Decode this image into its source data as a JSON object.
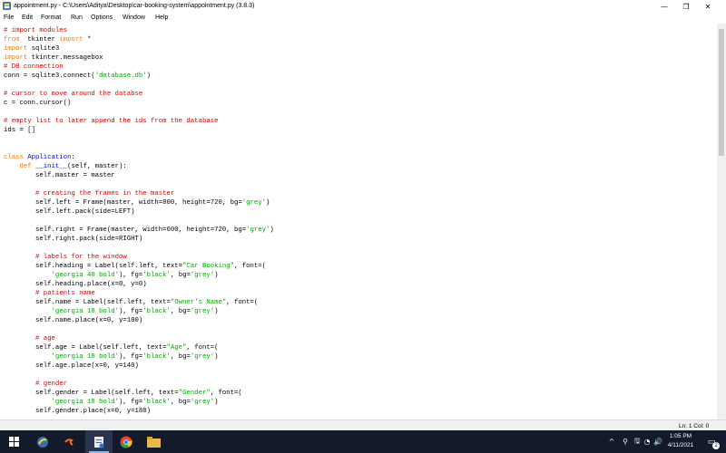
{
  "window": {
    "title": "appointment.py - C:\\Users\\Aditya\\Desktop\\car-booking-system\\appointment.py (3.8.3)",
    "controls": {
      "minimize_glyph": "—",
      "maximize_glyph": "❐",
      "close_glyph": "✕"
    }
  },
  "menu": [
    "File",
    "Edit",
    "Format",
    "Run",
    "Options",
    "Window",
    "Help"
  ],
  "code": [
    [
      [
        "cm",
        "# import modules"
      ]
    ],
    [
      [
        "kw",
        "from"
      ],
      [
        "",
        "  tkinter "
      ],
      [
        "kw",
        "import"
      ],
      [
        "",
        " *"
      ]
    ],
    [
      [
        "kw",
        "import"
      ],
      [
        "",
        " sqlite3"
      ]
    ],
    [
      [
        "kw",
        "import"
      ],
      [
        "",
        " tkinter.messagebox"
      ]
    ],
    [
      [
        "cm",
        "# DB connection"
      ]
    ],
    [
      [
        "",
        "conn = sqlite3.connect("
      ],
      [
        "st",
        "'database.db'"
      ],
      [
        "",
        ")"
      ]
    ],
    [],
    [
      [
        "cm",
        "# cursor to move around the databse"
      ]
    ],
    [
      [
        "",
        "c = conn.cursor()"
      ]
    ],
    [],
    [
      [
        "cm",
        "# empty list to later append the ids from the database"
      ]
    ],
    [
      [
        "",
        "ids = []"
      ]
    ],
    [],
    [],
    [
      [
        "kw",
        "class"
      ],
      [
        "",
        " "
      ],
      [
        "df",
        "Application"
      ],
      [
        "",
        ":"
      ]
    ],
    [
      [
        "",
        "    "
      ],
      [
        "kw",
        "def"
      ],
      [
        "",
        " "
      ],
      [
        "df",
        "__init__"
      ],
      [
        "",
        "(self, master):"
      ]
    ],
    [
      [
        "",
        "        self.master = master"
      ]
    ],
    [],
    [
      [
        "",
        "        "
      ],
      [
        "cm",
        "# creating the frames in the master"
      ]
    ],
    [
      [
        "",
        "        self.left = Frame(master, width=800, height=720, bg="
      ],
      [
        "st",
        "'grey'"
      ],
      [
        "",
        ")"
      ]
    ],
    [
      [
        "",
        "        self.left.pack(side=LEFT)"
      ]
    ],
    [],
    [
      [
        "",
        "        self.right = Frame(master, width=600, height=720, bg="
      ],
      [
        "st",
        "'grey'"
      ],
      [
        "",
        ")"
      ]
    ],
    [
      [
        "",
        "        self.right.pack(side=RIGHT)"
      ]
    ],
    [],
    [
      [
        "",
        "        "
      ],
      [
        "cm",
        "# labels for the window"
      ]
    ],
    [
      [
        "",
        "        self.heading = Label(self.left, text="
      ],
      [
        "st",
        "\"Car Booking\""
      ],
      [
        "",
        ", font=("
      ]
    ],
    [
      [
        "",
        "            "
      ],
      [
        "st",
        "'georgia 40 bold'"
      ],
      [
        "",
        "), fg="
      ],
      [
        "st",
        "'black'"
      ],
      [
        "",
        ", bg="
      ],
      [
        "st",
        "'grey'"
      ],
      [
        "",
        ")"
      ]
    ],
    [
      [
        "",
        "        self.heading.place(x=0, y=0)"
      ]
    ],
    [
      [
        "",
        "        "
      ],
      [
        "cm",
        "# patients name"
      ]
    ],
    [
      [
        "",
        "        self.name = Label(self.left, text="
      ],
      [
        "st",
        "\"Owner's Name\""
      ],
      [
        "",
        ", font=("
      ]
    ],
    [
      [
        "",
        "            "
      ],
      [
        "st",
        "'georgia 18 bold'"
      ],
      [
        "",
        "), fg="
      ],
      [
        "st",
        "'black'"
      ],
      [
        "",
        ", bg="
      ],
      [
        "st",
        "'grey'"
      ],
      [
        "",
        ")"
      ]
    ],
    [
      [
        "",
        "        self.name.place(x=0, y=100)"
      ]
    ],
    [],
    [
      [
        "",
        "        "
      ],
      [
        "cm",
        "# age"
      ]
    ],
    [
      [
        "",
        "        self.age = Label(self.left, text="
      ],
      [
        "st",
        "\"Age\""
      ],
      [
        "",
        ", font=("
      ]
    ],
    [
      [
        "",
        "            "
      ],
      [
        "st",
        "'georgia 18 bold'"
      ],
      [
        "",
        "), fg="
      ],
      [
        "st",
        "'black'"
      ],
      [
        "",
        ", bg="
      ],
      [
        "st",
        "'grey'"
      ],
      [
        "",
        ")"
      ]
    ],
    [
      [
        "",
        "        self.age.place(x=0, y=140)"
      ]
    ],
    [],
    [
      [
        "",
        "        "
      ],
      [
        "cm",
        "# gender"
      ]
    ],
    [
      [
        "",
        "        self.gender = Label(self.left, text="
      ],
      [
        "st",
        "\"Gender\""
      ],
      [
        "",
        ", font=("
      ]
    ],
    [
      [
        "",
        "            "
      ],
      [
        "st",
        "'georgia 18 bold'"
      ],
      [
        "",
        "), fg="
      ],
      [
        "st",
        "'black'"
      ],
      [
        "",
        ", bg="
      ],
      [
        "st",
        "'grey'"
      ],
      [
        "",
        ")"
      ]
    ],
    [
      [
        "",
        "        self.gender.place(x=0, y=180)"
      ]
    ]
  ],
  "status": {
    "line_col": "Ln: 1   Col: 0"
  },
  "taskbar": {
    "time": "1:05 PM",
    "date": "4/11/2021",
    "notification_count": "2",
    "tray_chevron": "^",
    "tray_icons": [
      "⚲",
      "🖫",
      "◔",
      "🔊"
    ]
  }
}
